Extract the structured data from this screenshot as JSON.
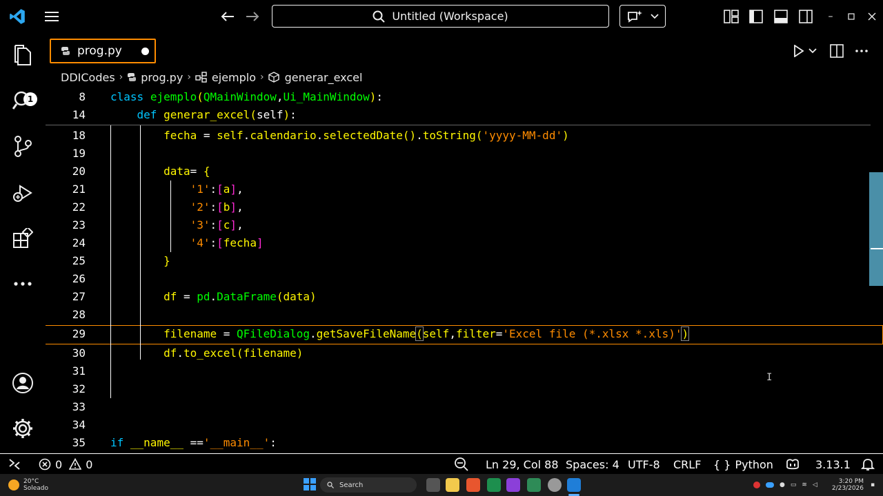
{
  "titlebar": {
    "search_text": "Untitled (Workspace)"
  },
  "activity": {
    "explorer_badge": "1"
  },
  "tab": {
    "label": "prog.py"
  },
  "breadcrumb": {
    "items": [
      "DDICodes",
      "prog.py",
      "ejemplo",
      "generar_excel"
    ]
  },
  "editor": {
    "line_numbers": [
      "8",
      "14",
      "18",
      "19",
      "20",
      "21",
      "22",
      "23",
      "24",
      "25",
      "26",
      "27",
      "28",
      "29",
      "30",
      "31",
      "32",
      "33",
      "34",
      "35"
    ]
  },
  "statusbar": {
    "errors": "0",
    "warnings": "0",
    "position": "Ln 29, Col 88",
    "spaces": "Spaces: 4",
    "encoding": "UTF-8",
    "eol": "CRLF",
    "language": "Python",
    "version": "3.13.1"
  },
  "taskbar": {
    "weather_temp": "20°C",
    "weather_desc": "Soleado",
    "search_label": "Search",
    "time": "3:20 PM",
    "date": "2/23/2026"
  },
  "colors": {
    "keyword": "#00c5ff",
    "function": "#fff700",
    "class": "#00ff00",
    "string": "#ff8c00",
    "accent": "#ff8c00"
  }
}
